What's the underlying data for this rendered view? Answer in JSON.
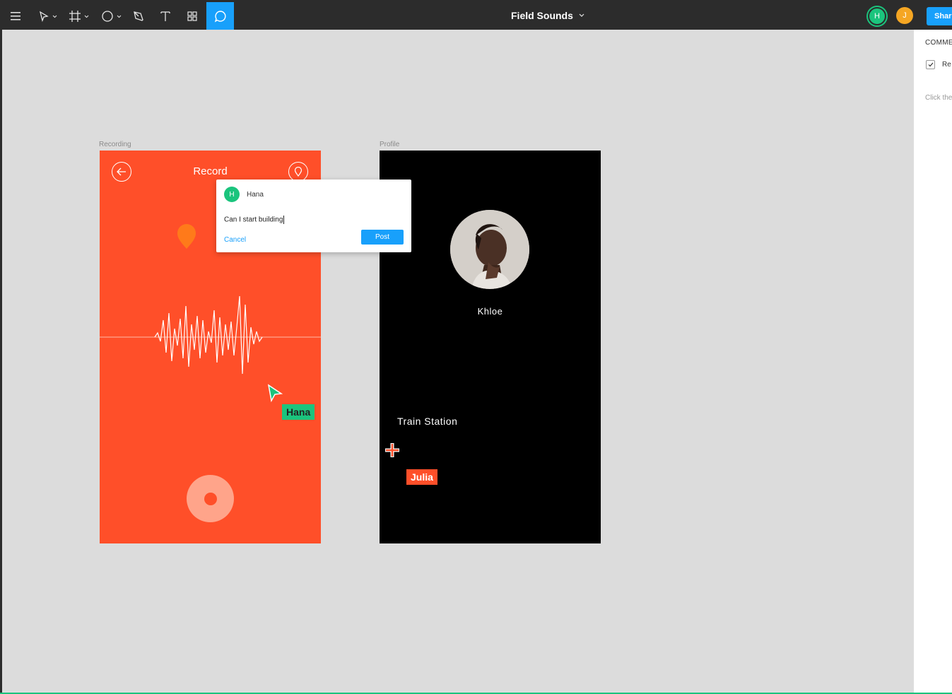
{
  "toolbar": {
    "menu_icon": "hamburger-icon",
    "tools": [
      "move-icon",
      "frame-icon",
      "shape-icon",
      "pen-icon",
      "text-icon",
      "components-icon",
      "comment-icon"
    ],
    "active_tool": "comment-icon",
    "document_title": "Field Sounds",
    "avatars": [
      {
        "initial": "H",
        "color": "#1bc47d"
      },
      {
        "initial": "J",
        "color": "#f5a623"
      }
    ],
    "share_label": "Share"
  },
  "canvas": {
    "background": "#dcdcdc",
    "frames": {
      "recording": {
        "label": "Recording",
        "title": "Record",
        "background": "#ff4f29"
      },
      "profile": {
        "label": "Profile",
        "name": "Khloe",
        "station": "Train Station",
        "background": "#000000"
      }
    },
    "cursors": {
      "hana": {
        "name": "Hana",
        "color": "#1bc47d"
      },
      "julia": {
        "name": "Julia",
        "color": "#ff4f29"
      }
    },
    "comment": {
      "author_initial": "H",
      "author": "Hana",
      "draft_text": "Can I start building",
      "cancel_label": "Cancel",
      "post_label": "Post"
    }
  },
  "right_panel": {
    "header": "COMME",
    "checkbox_label": "Re",
    "hint": "Click the"
  }
}
